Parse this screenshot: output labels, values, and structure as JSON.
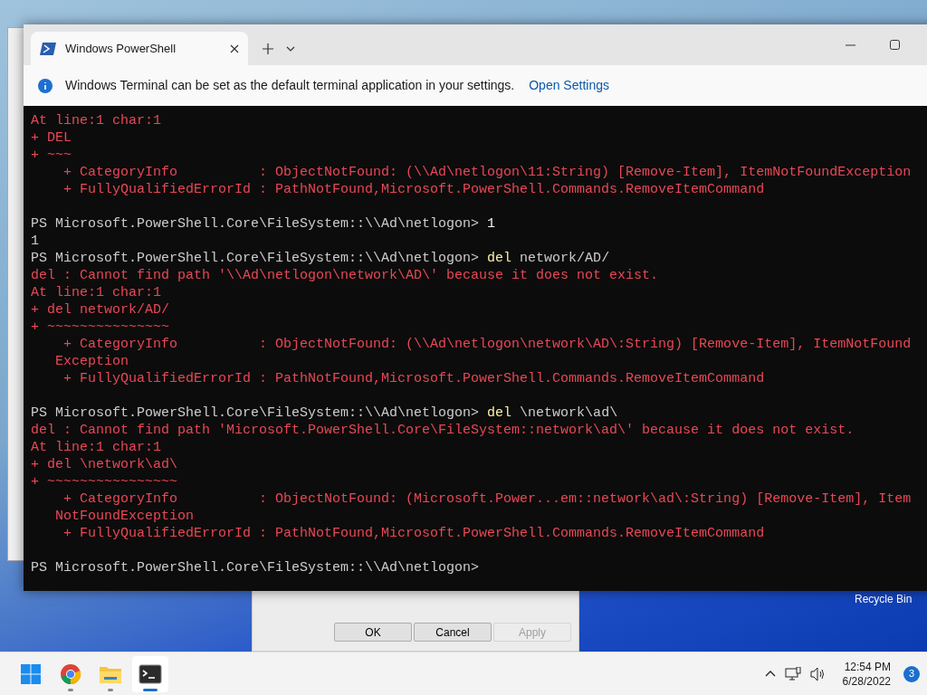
{
  "terminal_window": {
    "tabs": [
      {
        "label": "Windows PowerShell",
        "selected": true
      }
    ],
    "infobar": {
      "message": "Windows Terminal can be set as the default terminal application in your settings.",
      "link": "Open Settings"
    },
    "lines": [
      {
        "kind": "error",
        "text": "At line:1 char:1"
      },
      {
        "kind": "error",
        "text": "+ DEL"
      },
      {
        "kind": "error",
        "text": "+ ~~~"
      },
      {
        "kind": "error",
        "text": "    + CategoryInfo          : ObjectNotFound: (\\\\Ad\\netlogon\\11:String) [Remove-Item], ItemNotFoundException"
      },
      {
        "kind": "error",
        "text": "    + FullyQualifiedErrorId : PathNotFound,Microsoft.PowerShell.Commands.RemoveItemCommand"
      },
      {
        "kind": "blank"
      },
      {
        "kind": "prompt",
        "text": "PS Microsoft.PowerShell.Core\\FileSystem::\\\\Ad\\netlogon> ",
        "command": "1",
        "highlighted": false
      },
      {
        "kind": "output",
        "text": "1"
      },
      {
        "kind": "prompt",
        "text": "PS Microsoft.PowerShell.Core\\FileSystem::\\\\Ad\\netlogon> ",
        "command": "del",
        "args": " network/AD/",
        "highlighted": true
      },
      {
        "kind": "error",
        "text": "del : Cannot find path '\\\\Ad\\netlogon\\network\\AD\\' because it does not exist."
      },
      {
        "kind": "error",
        "text": "At line:1 char:1"
      },
      {
        "kind": "error",
        "text": "+ del network/AD/"
      },
      {
        "kind": "error",
        "text": "+ ~~~~~~~~~~~~~~~"
      },
      {
        "kind": "error",
        "text": "    + CategoryInfo          : ObjectNotFound: (\\\\Ad\\netlogon\\network\\AD\\:String) [Remove-Item], ItemNotFound"
      },
      {
        "kind": "error",
        "text": "   Exception"
      },
      {
        "kind": "error",
        "text": "    + FullyQualifiedErrorId : PathNotFound,Microsoft.PowerShell.Commands.RemoveItemCommand"
      },
      {
        "kind": "blank"
      },
      {
        "kind": "prompt",
        "text": "PS Microsoft.PowerShell.Core\\FileSystem::\\\\Ad\\netlogon> ",
        "command": "del",
        "args": " \\network\\ad\\",
        "highlighted": true
      },
      {
        "kind": "error",
        "text": "del : Cannot find path 'Microsoft.PowerShell.Core\\FileSystem::network\\ad\\' because it does not exist."
      },
      {
        "kind": "error",
        "text": "At line:1 char:1"
      },
      {
        "kind": "error",
        "text": "+ del \\network\\ad\\"
      },
      {
        "kind": "error",
        "text": "+ ~~~~~~~~~~~~~~~~"
      },
      {
        "kind": "error",
        "text": "    + CategoryInfo          : ObjectNotFound: (Microsoft.Power...em::network\\ad\\:String) [Remove-Item], Item"
      },
      {
        "kind": "error",
        "text": "   NotFoundException"
      },
      {
        "kind": "error",
        "text": "    + FullyQualifiedErrorId : PathNotFound,Microsoft.PowerShell.Commands.RemoveItemCommand"
      },
      {
        "kind": "blank"
      },
      {
        "kind": "prompt",
        "text": "PS Microsoft.PowerShell.Core\\FileSystem::\\\\Ad\\netlogon>"
      }
    ]
  },
  "dialog": {
    "buttons": [
      {
        "label": "OK",
        "disabled": false
      },
      {
        "label": "Cancel",
        "disabled": false
      },
      {
        "label": "Apply",
        "disabled": true
      }
    ]
  },
  "desktop_icons": [
    {
      "label": "Recycle Bin"
    }
  ],
  "taskbar": {
    "apps": [
      {
        "kind": "chrome",
        "selected": false
      },
      {
        "kind": "folder",
        "selected": false
      },
      {
        "kind": "terminal",
        "selected": true
      }
    ],
    "time": "12:54 PM",
    "date": "6/28/2022",
    "notifications": "3"
  }
}
